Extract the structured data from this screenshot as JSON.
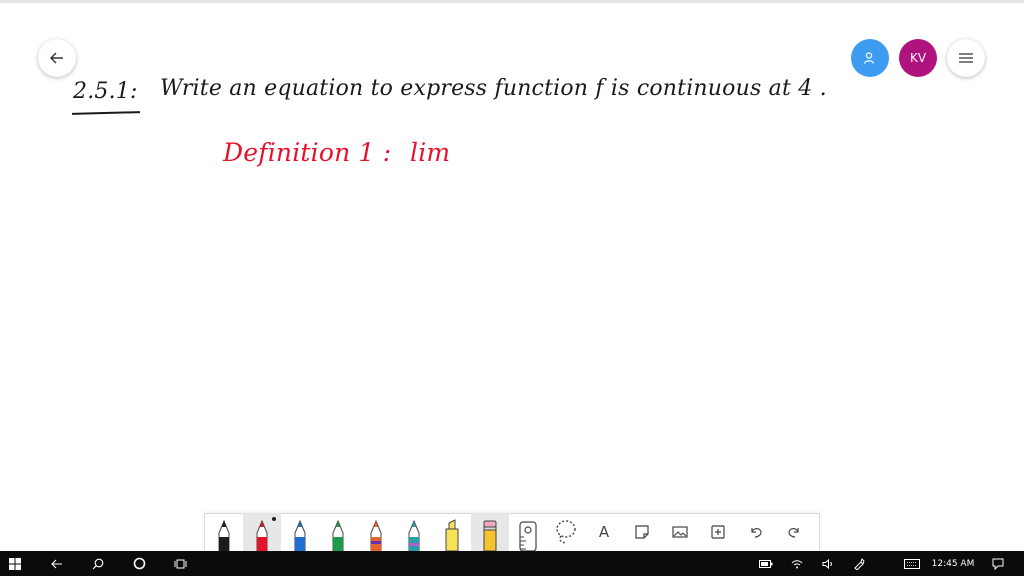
{
  "header": {
    "back_icon": "arrow-left-icon",
    "user_icon": "person-icon",
    "avatar_initials": "KV",
    "menu_icon": "hamburger-menu-icon",
    "user_color": "#3e9bf2",
    "avatar_color": "#b0127e"
  },
  "canvas": {
    "problem_number": "2.5.1:",
    "problem_text": "Write an equation to express function f is continuous at 4 .",
    "definition_label": "Definition 1 :",
    "definition_start": "lim",
    "ink_colors": {
      "black": "#1a1a1a",
      "red": "#e4122b"
    }
  },
  "toolbar": {
    "tools": [
      {
        "name": "pen-black",
        "color": "#1a1a1a"
      },
      {
        "name": "pen-red",
        "color": "#e4122b",
        "selected": true
      },
      {
        "name": "pen-blue",
        "color": "#1f6fd0"
      },
      {
        "name": "pen-green",
        "color": "#1e9a4a"
      },
      {
        "name": "pen-orange",
        "color": "#e7642b"
      },
      {
        "name": "pen-teal",
        "color": "#27a0a8"
      },
      {
        "name": "highlighter-yellow",
        "color": "#f6e35a"
      },
      {
        "name": "pencil-eraser",
        "color": "#f4c430"
      }
    ],
    "text_tool_label": "A"
  },
  "taskbar": {
    "clock": "12:45 AM"
  }
}
